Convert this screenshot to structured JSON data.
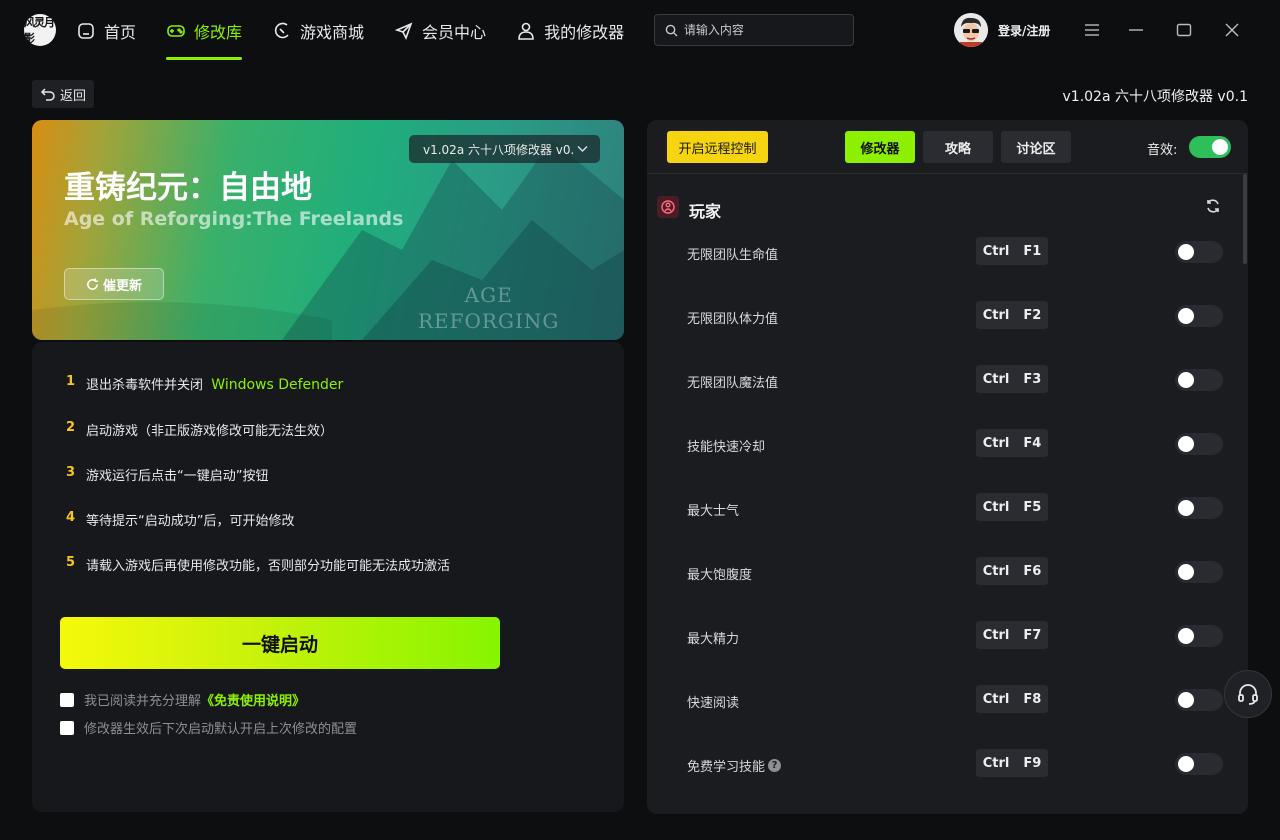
{
  "app": {
    "logo_text": "风灵月影"
  },
  "nav": [
    {
      "label": "首页",
      "icon": "home-icon"
    },
    {
      "label": "修改库",
      "icon": "gamepad-icon",
      "active": true
    },
    {
      "label": "游戏商城",
      "icon": "store-icon"
    },
    {
      "label": "会员中心",
      "icon": "send-icon"
    },
    {
      "label": "我的修改器",
      "icon": "user-icon"
    }
  ],
  "search": {
    "placeholder": "请输入内容"
  },
  "user": {
    "login_label": "登录/注册"
  },
  "back_label": "返回",
  "version_top": "v1.02a 六十八项修改器 v0.1",
  "banner": {
    "version_select": "v1.02a 六十八项修改器 v0.1",
    "title_cn": "重铸纪元：自由地",
    "title_en": "Age of Reforging:The Freelands",
    "update_label": "催更新",
    "logo_line1": "AGE",
    "logo_line2": "REFORGING"
  },
  "steps": [
    {
      "num": "1",
      "text": "退出杀毒软件并关闭",
      "highlight": "Windows Defender"
    },
    {
      "num": "2",
      "text": "启动游戏（非正版游戏修改可能无法生效）"
    },
    {
      "num": "3",
      "text": "游戏运行后点击“一键启动”按钮"
    },
    {
      "num": "4",
      "text": "等待提示“启动成功”后，可开始修改"
    },
    {
      "num": "5",
      "text": "请载入游戏后再使用修改功能，否则部分功能可能无法成功激活"
    }
  ],
  "launch_label": "一键启动",
  "checks": [
    {
      "text": "我已阅读并充分理解",
      "link": "《免责使用说明》"
    },
    {
      "text": "修改器生效后下次启动默认开启上次修改的配置"
    }
  ],
  "panel": {
    "remote_label": "开启远程控制",
    "tabs": [
      {
        "label": "修改器",
        "active": true
      },
      {
        "label": "攻略"
      },
      {
        "label": "讨论区"
      }
    ],
    "sound_label": "音效:",
    "sound_on": true,
    "section_title": "玩家",
    "features": [
      {
        "name": "无限团队生命值",
        "mod": "Ctrl",
        "key": "F1",
        "on": false
      },
      {
        "name": "无限团队体力值",
        "mod": "Ctrl",
        "key": "F2",
        "on": false
      },
      {
        "name": "无限团队魔法值",
        "mod": "Ctrl",
        "key": "F3",
        "on": false
      },
      {
        "name": "技能快速冷却",
        "mod": "Ctrl",
        "key": "F4",
        "on": false
      },
      {
        "name": "最大士气",
        "mod": "Ctrl",
        "key": "F5",
        "on": false
      },
      {
        "name": "最大饱腹度",
        "mod": "Ctrl",
        "key": "F6",
        "on": false
      },
      {
        "name": "最大精力",
        "mod": "Ctrl",
        "key": "F7",
        "on": false
      },
      {
        "name": "快速阅读",
        "mod": "Ctrl",
        "key": "F8",
        "on": false
      },
      {
        "name": "免费学习技能",
        "mod": "Ctrl",
        "key": "F9",
        "on": false,
        "help": "?"
      }
    ]
  },
  "colors": {
    "accent": "#8cf000",
    "yellow": "#f6d40f",
    "toggle_on": "#2fbf5a"
  }
}
